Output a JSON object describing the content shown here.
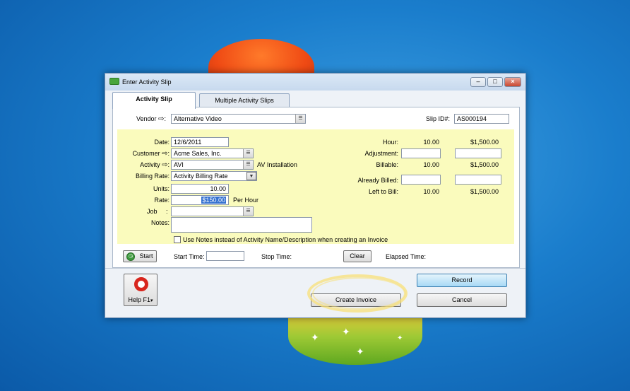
{
  "window": {
    "title": "Enter Activity Slip"
  },
  "tabs": [
    {
      "label": "Activity Slip"
    },
    {
      "label": "Multiple Activity Slips"
    }
  ],
  "vendor": {
    "label": "Vendor",
    "value": "Alternative Video"
  },
  "slip": {
    "label": "Slip ID#:",
    "value": "AS000194"
  },
  "form": {
    "date": {
      "label": "Date:",
      "value": "12/6/2011"
    },
    "customer": {
      "label": "Customer",
      "value": "Acme Sales, Inc."
    },
    "activity": {
      "label": "Activity",
      "value": "AVI",
      "description": "AV Installation"
    },
    "billing_rate": {
      "label": "Billing Rate:",
      "value": "Activity Billing Rate"
    },
    "units": {
      "label": "Units:",
      "value": "10.00"
    },
    "rate": {
      "label": "Rate:",
      "value": "$150.00",
      "suffix": "Per Hour"
    },
    "job": {
      "label": "Job",
      "colon": ":",
      "value": ""
    },
    "notes": {
      "label": "Notes:",
      "value": ""
    },
    "use_notes": {
      "label": "Use Notes instead of Activity Name/Description when creating an Invoice",
      "checked": false
    }
  },
  "summary": {
    "hour": {
      "label": "Hour:",
      "units": "10.00",
      "amount": "$1,500.00"
    },
    "adjustment": {
      "label": "Adjustment:"
    },
    "billable": {
      "label": "Billable:",
      "units": "10.00",
      "amount": "$1,500.00"
    },
    "already_billed": {
      "label": "Already Billed:"
    },
    "left_to_bill": {
      "label": "Left to Bill:",
      "units": "10.00",
      "amount": "$1,500.00"
    }
  },
  "timer": {
    "start_label": "Start",
    "start_time_label": "Start Time:",
    "stop_time_label": "Stop Time:",
    "clear_label": "Clear",
    "elapsed_label": "Elapsed Time:"
  },
  "buttons": {
    "help": "Help F1",
    "record": "Record",
    "create_invoice": "Create Invoice",
    "cancel": "Cancel"
  },
  "icons": {
    "vendor_arrow": "arrow-right-icon",
    "help": "life-ring-icon",
    "start": "clock-icon"
  }
}
